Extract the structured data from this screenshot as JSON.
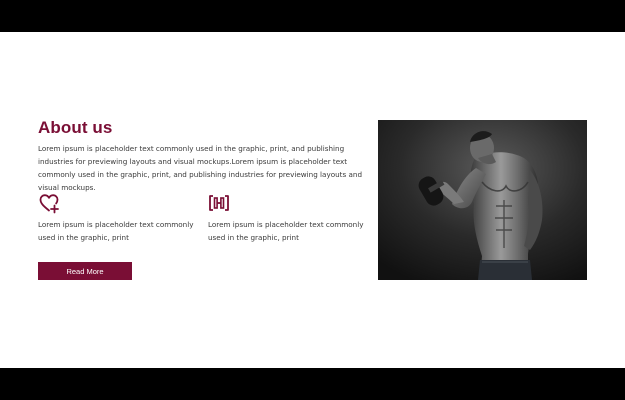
{
  "about": {
    "title": "About us",
    "intro": "Lorem ipsum is placeholder text commonly used in the graphic, print, and publishing industries for previewing layouts and visual mockups.Lorem ipsum is placeholder text commonly used in the graphic, print, and publishing industries for previewing layouts and visual mockups."
  },
  "features": [
    {
      "icon": "heart-plus-icon",
      "text": "Lorem ipsum is placeholder text commonly used in the graphic, print"
    },
    {
      "icon": "dumbbell-icon",
      "text": "Lorem ipsum is placeholder text commonly used in the graphic, print"
    }
  ],
  "cta": {
    "label": "Read More"
  },
  "image": {
    "subject": "bodybuilder-curling-dumbbell-photo"
  },
  "colors": {
    "accent": "#7a0e35",
    "text": "#3a3a3a",
    "background": "#ffffff",
    "letterbox": "#000000"
  }
}
